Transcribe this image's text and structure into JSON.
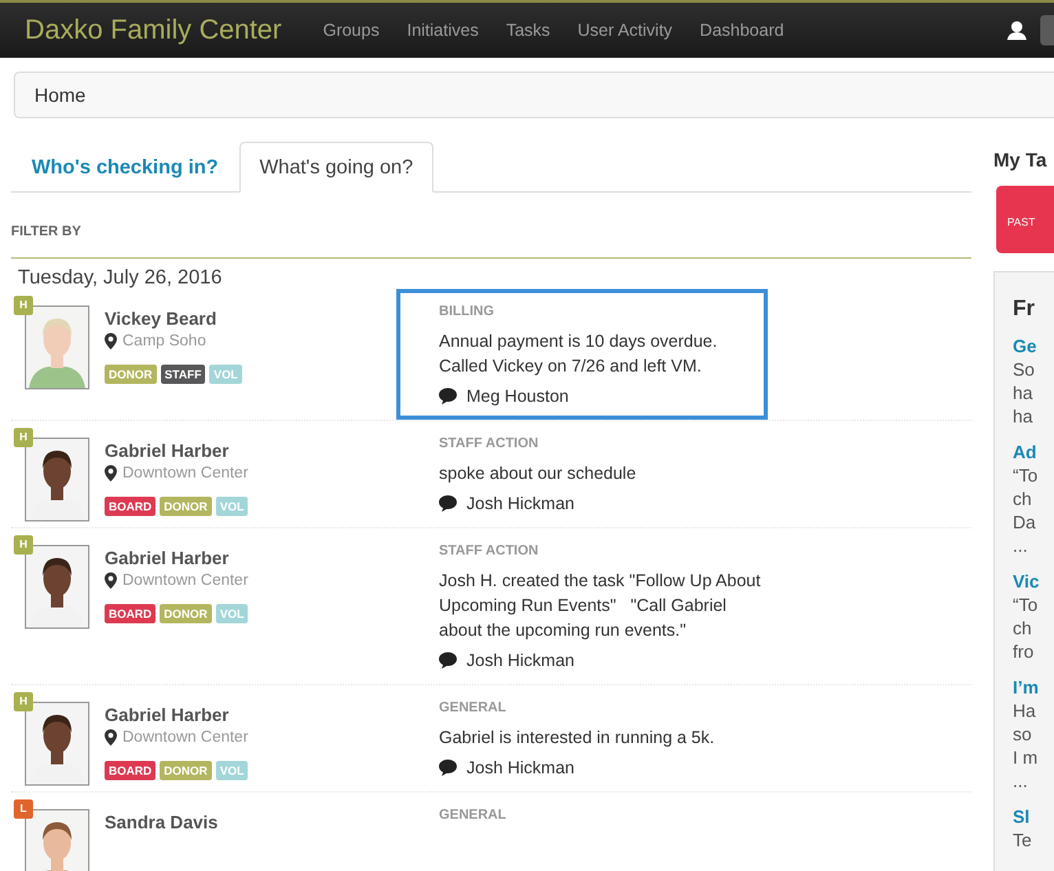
{
  "navbar": {
    "brand": "Daxko Family Center",
    "links": [
      "Groups",
      "Initiatives",
      "Tasks",
      "User Activity",
      "Dashboard"
    ]
  },
  "breadcrumb": "Home",
  "tabs": [
    {
      "label": "Who's checking in?",
      "selected": false
    },
    {
      "label": "What's going on?",
      "selected": true
    }
  ],
  "filter_label": "FILTER BY",
  "date": "Tuesday, July 26, 2016",
  "entries": [
    {
      "badge": {
        "letter": "H",
        "color": "#a9b04f"
      },
      "photo": {
        "kind": "picture"
      },
      "name": "Vickey Beard",
      "location": "Camp Soho",
      "tags": [
        {
          "label": "DONOR",
          "color": "#b3b65e"
        },
        {
          "label": "STAFF",
          "color": "#58585a"
        },
        {
          "label": "VOL",
          "color": "#a3d6d9"
        }
      ],
      "category": "BILLING",
      "text": "Annual payment is 10 days overdue.\nCalled Vickey on 7/26 and left VM.",
      "author": "Meg Houston",
      "highlighted": true
    },
    {
      "badge": {
        "letter": "H",
        "color": "#a9b04f"
      },
      "photo": {
        "kind": "picture"
      },
      "name": "Gabriel Harber",
      "location": "Downtown Center",
      "tags": [
        {
          "label": "BOARD",
          "color": "#dd3a52"
        },
        {
          "label": "DONOR",
          "color": "#b3b65e"
        },
        {
          "label": "VOL",
          "color": "#a3d6d9"
        }
      ],
      "category": "STAFF ACTION",
      "text": "spoke about our schedule",
      "author": "Josh Hickman",
      "highlighted": false
    },
    {
      "badge": {
        "letter": "H",
        "color": "#a9b04f"
      },
      "photo": {
        "kind": "picture"
      },
      "name": "Gabriel Harber",
      "location": "Downtown Center",
      "tags": [
        {
          "label": "BOARD",
          "color": "#dd3a52"
        },
        {
          "label": "DONOR",
          "color": "#b3b65e"
        },
        {
          "label": "VOL",
          "color": "#a3d6d9"
        }
      ],
      "category": "STAFF ACTION",
      "text": "Josh H. created the task \"Follow Up About\nUpcoming Run Events\"   \"Call Gabriel\nabout the upcoming run events.\"",
      "author": "Josh Hickman",
      "highlighted": false
    },
    {
      "badge": {
        "letter": "H",
        "color": "#a9b04f"
      },
      "photo": {
        "kind": "picture"
      },
      "name": "Gabriel Harber",
      "location": "Downtown Center",
      "tags": [
        {
          "label": "BOARD",
          "color": "#dd3a52"
        },
        {
          "label": "DONOR",
          "color": "#b3b65e"
        },
        {
          "label": "VOL",
          "color": "#a3d6d9"
        }
      ],
      "category": "GENERAL",
      "text": "Gabriel is interested in running a 5k.",
      "author": "Josh Hickman",
      "highlighted": false
    },
    {
      "badge": {
        "letter": "L",
        "color": "#e0652c"
      },
      "photo": {
        "kind": "picture"
      },
      "name": "Sandra Davis",
      "category": "GENERAL",
      "highlighted": false
    }
  ],
  "sidebar": {
    "title": "My Ta",
    "alert": "PAST",
    "panel": {
      "title": "Fr",
      "items": [
        {
          "title": "Ge",
          "lines": [
            "So",
            "ha",
            "ha"
          ]
        },
        {
          "title": "Ad",
          "lines": [
            "“To",
            "ch",
            "Da",
            "..."
          ]
        },
        {
          "title": "Vic",
          "lines": [
            "“To",
            "ch",
            "fro"
          ]
        },
        {
          "title": "I’m",
          "lines": [
            "Ha",
            "so",
            "I m",
            "..."
          ]
        },
        {
          "title": "Sl",
          "lines": [
            "Te"
          ]
        }
      ]
    }
  }
}
